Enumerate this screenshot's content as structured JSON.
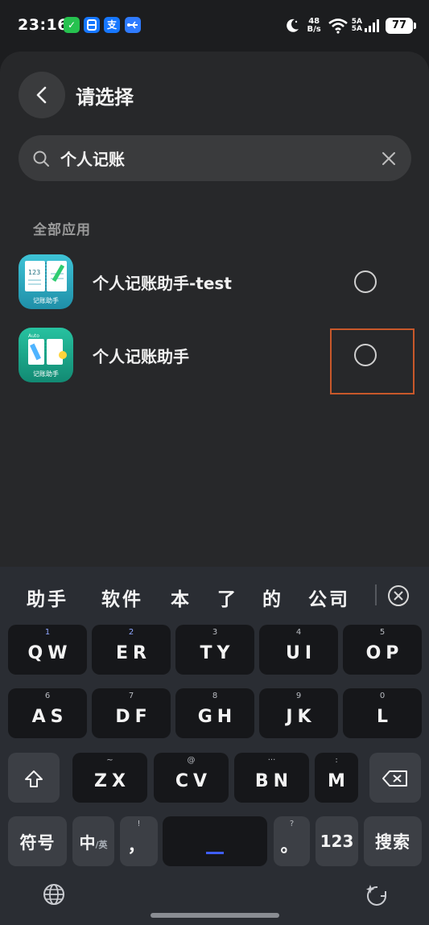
{
  "status_bar": {
    "time": "23:16",
    "speed_value": "48",
    "speed_unit": "B/s",
    "net_top": "5A",
    "net_bottom": "5A",
    "battery": "77"
  },
  "header": {
    "title": "请选择"
  },
  "search": {
    "value": "个人记账",
    "placeholder": ""
  },
  "section": {
    "label": "全部应用"
  },
  "apps": [
    {
      "name": "个人记账助手-test",
      "icon_caption": "记账助手",
      "icon_number": "123",
      "selected": false
    },
    {
      "name": "个人记账助手",
      "icon_caption": "记账助手",
      "icon_number": "Auto",
      "selected": false
    }
  ],
  "keyboard": {
    "candidates": [
      "助手",
      "软件",
      "本",
      "了",
      "的",
      "公司"
    ],
    "rows": [
      [
        {
          "main": "QW",
          "sub": "1"
        },
        {
          "main": "ER",
          "sub": "2"
        },
        {
          "main": "TY",
          "sub": "3"
        },
        {
          "main": "UI",
          "sub": "4"
        },
        {
          "main": "OP",
          "sub": "5"
        }
      ],
      [
        {
          "main": "AS",
          "sub": "6"
        },
        {
          "main": "DF",
          "sub": "7"
        },
        {
          "main": "GH",
          "sub": "8"
        },
        {
          "main": "JK",
          "sub": "9"
        },
        {
          "main": "L",
          "sub": "0"
        }
      ],
      [
        {
          "main": "ZX",
          "sub": "~"
        },
        {
          "main": "CV",
          "sub": "@"
        },
        {
          "main": "BN",
          "sub": "···"
        },
        {
          "main": "M",
          "sub": ":"
        }
      ]
    ],
    "symbols_label": "符号",
    "lang_label_main": "中",
    "lang_label_sub": "/英",
    "comma_label": "，",
    "comma_sub": "!",
    "period_label": "。",
    "period_sub": "?",
    "numbers_label": "123",
    "search_label": "搜索"
  },
  "colors": {
    "background": "#1c1d1f",
    "sheet": "#27282a",
    "keyboard": "#2a2d33",
    "key": "#16171a",
    "accent_cursor": "#3f5fff",
    "highlight": "#c8582a"
  }
}
